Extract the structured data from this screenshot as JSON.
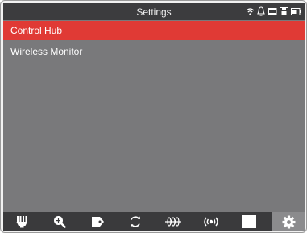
{
  "window": {
    "title": "Settings"
  },
  "status_bar": {
    "icons": [
      "wifi-icon",
      "bell-icon",
      "card-icon",
      "save-icon",
      "battery-icon"
    ]
  },
  "menu": {
    "items": [
      {
        "label": "Control Hub",
        "selected": true
      },
      {
        "label": "Wireless Monitor",
        "selected": false
      }
    ]
  },
  "toolbar": {
    "icons": [
      "probe-icon",
      "zoom-in-icon",
      "tag-icon",
      "refresh-icon",
      "signal-wave-icon",
      "broadcast-icon",
      "blank-square-icon",
      "gear-icon"
    ],
    "selected": "gear-icon"
  },
  "colors": {
    "accent": "#e03a35",
    "background": "#79797b",
    "bar": "#3c3c3e",
    "selected_tool": "#8b8b8d"
  }
}
